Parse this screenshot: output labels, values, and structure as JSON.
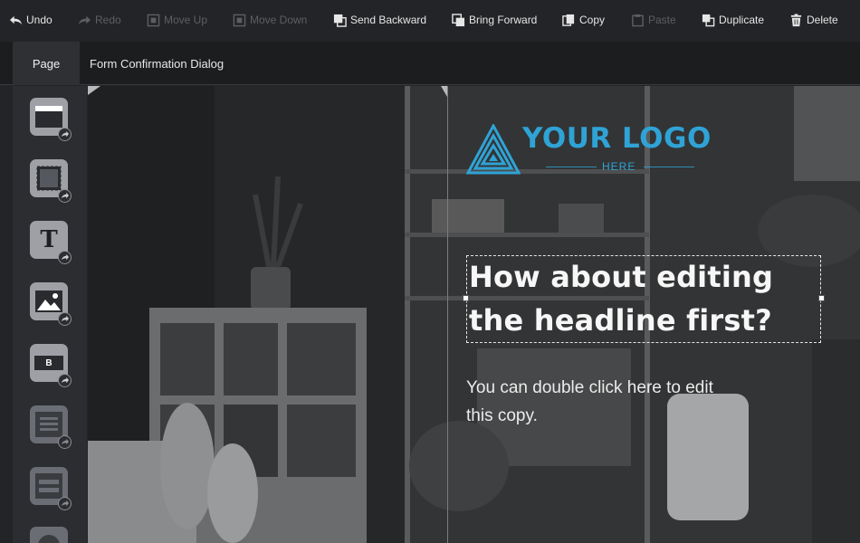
{
  "toolbar": {
    "undo": "Undo",
    "redo": "Redo",
    "move_up": "Move Up",
    "move_down": "Move Down",
    "send_backward": "Send Backward",
    "bring_forward": "Bring Forward",
    "copy": "Copy",
    "paste": "Paste",
    "duplicate": "Duplicate",
    "delete": "Delete"
  },
  "tabs": {
    "page": "Page",
    "title": "Form Confirmation Dialog"
  },
  "sidebar": {
    "items": [
      {
        "icon": "section-icon"
      },
      {
        "icon": "box-icon"
      },
      {
        "icon": "text-icon",
        "glyph": "T"
      },
      {
        "icon": "image-icon"
      },
      {
        "icon": "button-icon",
        "glyph": "B"
      },
      {
        "icon": "form-icon"
      },
      {
        "icon": "field-icon"
      },
      {
        "icon": "circle-icon"
      }
    ]
  },
  "canvas": {
    "logo_main": "YOUR LOGO",
    "logo_sub": "HERE",
    "headline_line1": "How about editing",
    "headline_line2": "the headline first?",
    "body_line1": "You can double click here to edit",
    "body_line2": "this copy."
  },
  "colors": {
    "accent": "#2fa3d6",
    "toolbar_bg": "#232427",
    "sidebar_bg": "#2c2d31",
    "disabled": "#5d5f63"
  }
}
